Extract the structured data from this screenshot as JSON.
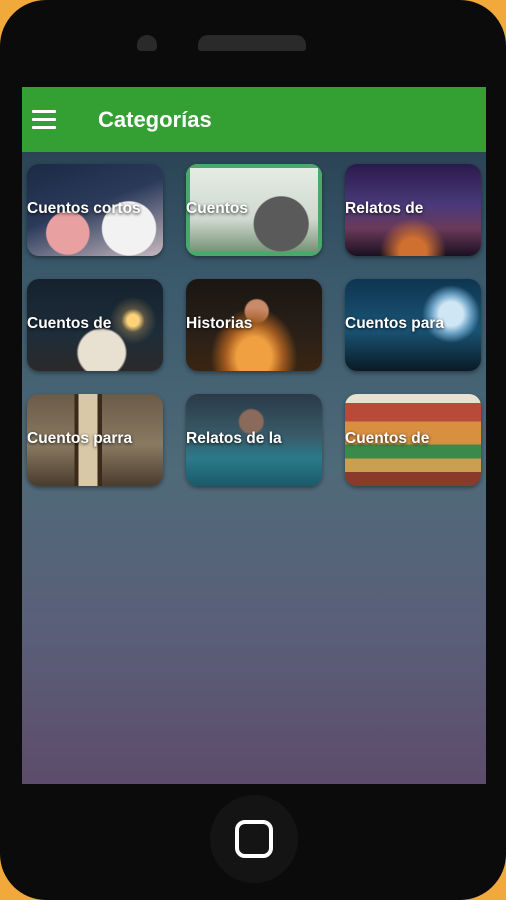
{
  "appbar": {
    "title": "Categorías",
    "menu_icon": "hamburger-menu-icon"
  },
  "categories": [
    {
      "label": "Cuentos cortos"
    },
    {
      "label": "Cuentos"
    },
    {
      "label": "Relatos de"
    },
    {
      "label": "Cuentos de"
    },
    {
      "label": "Historias"
    },
    {
      "label": "Cuentos para"
    },
    {
      "label": "Cuentos parra"
    },
    {
      "label": "Relatos de la"
    },
    {
      "label": "Cuentos de"
    }
  ],
  "colors": {
    "appbar": "#34a034",
    "bezel": "#0b0b0b",
    "background": "#f2a93b"
  }
}
